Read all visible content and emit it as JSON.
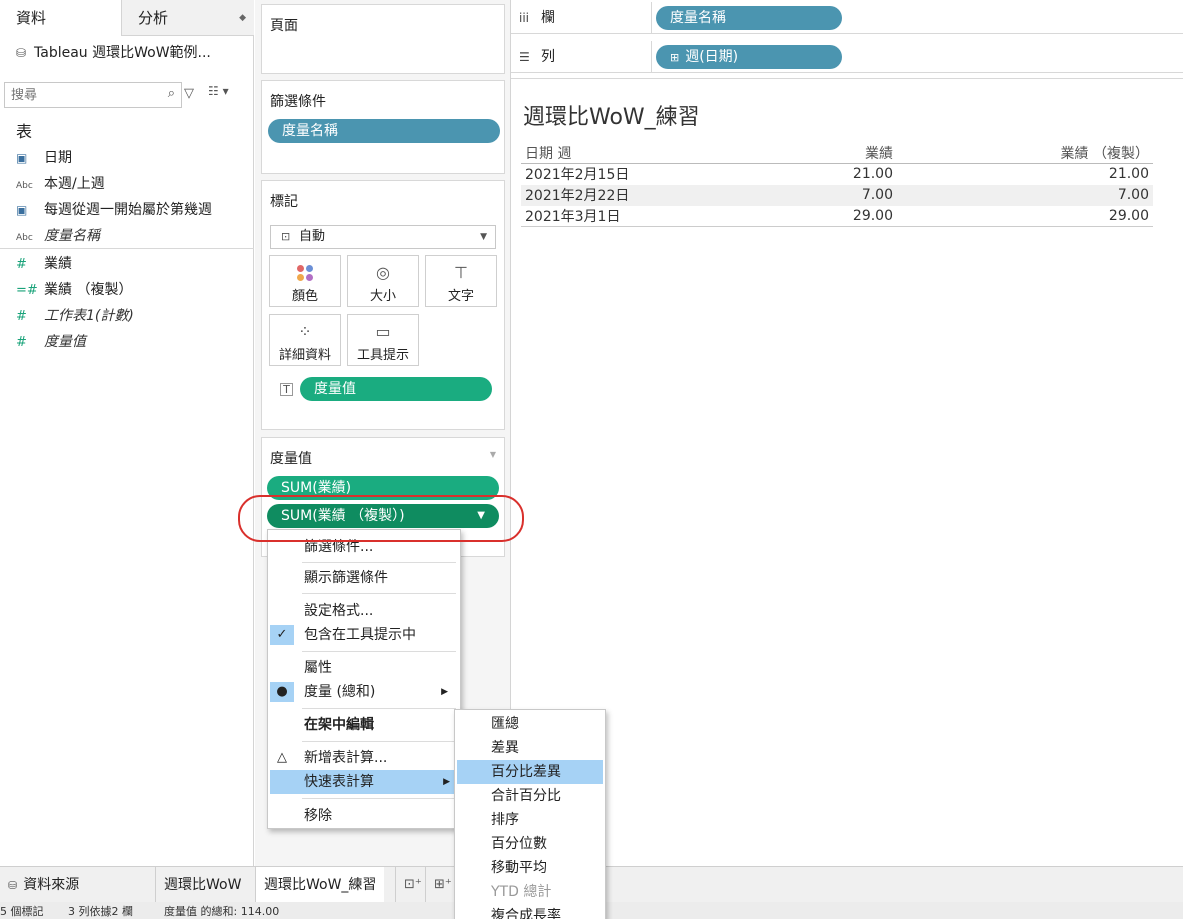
{
  "left_pane": {
    "tabs": {
      "data": "資料",
      "analysis": "分析"
    },
    "datasource": "Tableau 週環比WoW範例...",
    "search_placeholder": "搜尋",
    "section_title": "表",
    "dimensions": [
      {
        "type": "日",
        "name": "日期"
      },
      {
        "type": "Abc",
        "name": "本週/上週"
      },
      {
        "type": "日",
        "name": "每週從週一開始屬於第幾週"
      },
      {
        "type": "Abc",
        "name": "度量名稱"
      }
    ],
    "measures": [
      {
        "type": "#",
        "name": "業績"
      },
      {
        "type": "=#",
        "name": "業績 （複製）"
      },
      {
        "type": "#",
        "name": "工作表1(計數)"
      },
      {
        "type": "#",
        "name": "度量值"
      }
    ]
  },
  "cards": {
    "pages": "頁面",
    "filters": {
      "title": "篩選條件",
      "pill": "度量名稱"
    },
    "marks": {
      "title": "標記",
      "mark_type": "自動",
      "buttons": {
        "color": "顏色",
        "size": "大小",
        "text": "文字",
        "detail": "詳細資料",
        "tooltip": "工具提示"
      },
      "pill": "度量值"
    },
    "measure_values": {
      "title": "度量值",
      "pills": [
        "SUM(業績)",
        "SUM(業績 （複製）)"
      ]
    }
  },
  "shelves": {
    "columns": {
      "label": "欄",
      "pill": "度量名稱"
    },
    "rows": {
      "label": "列",
      "pill": "週(日期)"
    }
  },
  "view": {
    "title": "週環比WoW_練習",
    "headers": [
      "日期 週",
      "業績",
      "業績 （複製）"
    ],
    "rows": [
      [
        "2021年2月15日",
        "21.00",
        "21.00"
      ],
      [
        "2021年2月22日",
        "7.00",
        "7.00"
      ],
      [
        "2021年3月1日",
        "29.00",
        "29.00"
      ]
    ]
  },
  "context_menu": {
    "items": [
      "篩選條件...",
      "顯示篩選條件",
      "設定格式...",
      "包含在工具提示中",
      "屬性",
      "度量 (總和)",
      "在架中編輯",
      "新增表計算...",
      "快速表計算",
      "移除"
    ]
  },
  "quick_table_calc_menu": {
    "items": [
      "匯總",
      "差異",
      "百分比差異",
      "合計百分比",
      "排序",
      "百分位數",
      "移動平均",
      "YTD 總計",
      "複合成長率"
    ]
  },
  "bottom_tabs": {
    "datasource": "資料來源",
    "sheet1": "週環比WoW",
    "sheet2": "週環比WoW_練習"
  },
  "status": {
    "marks": "5 個標記",
    "rows_cols": "3 列依據2 欄",
    "sum": "度量值 的總和: 114.00"
  },
  "colors": {
    "blue_pill": "#4b95b0",
    "green_pill": "#1aac80",
    "highlight": "#a6d2f5",
    "annotation_ring": "#d9302c"
  }
}
